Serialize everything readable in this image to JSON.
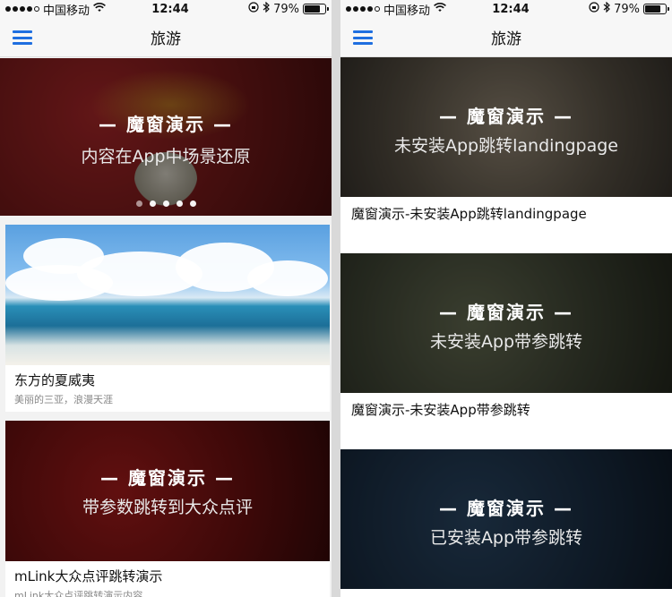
{
  "status_bar": {
    "carrier": "中国移动",
    "time": "12:44",
    "battery": "79%",
    "battery_level": 0.79
  },
  "nav": {
    "title": "旅游"
  },
  "left": {
    "banner": {
      "title": "— 魔窗演示 —",
      "subtitle": "内容在App中场景还原",
      "dots": 5,
      "active_dot": 0
    },
    "cards": [
      {
        "title": "东方的夏威夷",
        "subtitle": "美丽的三亚，浪漫天涯"
      },
      {
        "overlay_title": "— 魔窗演示 —",
        "overlay_subtitle": "带参数跳转到大众点评",
        "title": "mLink大众点评跳转演示",
        "subtitle": "mLink大众点评跳转演示内容"
      }
    ]
  },
  "right": {
    "cards": [
      {
        "overlay_title": "— 魔窗演示 —",
        "overlay_subtitle": "未安装App跳转landingpage",
        "caption": "魔窗演示-未安装App跳转landingpage"
      },
      {
        "overlay_title": "— 魔窗演示 —",
        "overlay_subtitle": "未安装App带参跳转",
        "caption": "魔窗演示-未安装App带参跳转"
      },
      {
        "overlay_title": "— 魔窗演示 —",
        "overlay_subtitle": "已安装App带参跳转"
      }
    ]
  },
  "icons": {
    "menu": "hamburger-menu-icon",
    "wifi": "wifi-icon",
    "lock": "rotation-lock-icon",
    "bluetooth": "bluetooth-icon",
    "battery": "battery-icon"
  },
  "colors": {
    "accent": "#1f6fe0",
    "navbar_bg": "#f7f7f7"
  }
}
